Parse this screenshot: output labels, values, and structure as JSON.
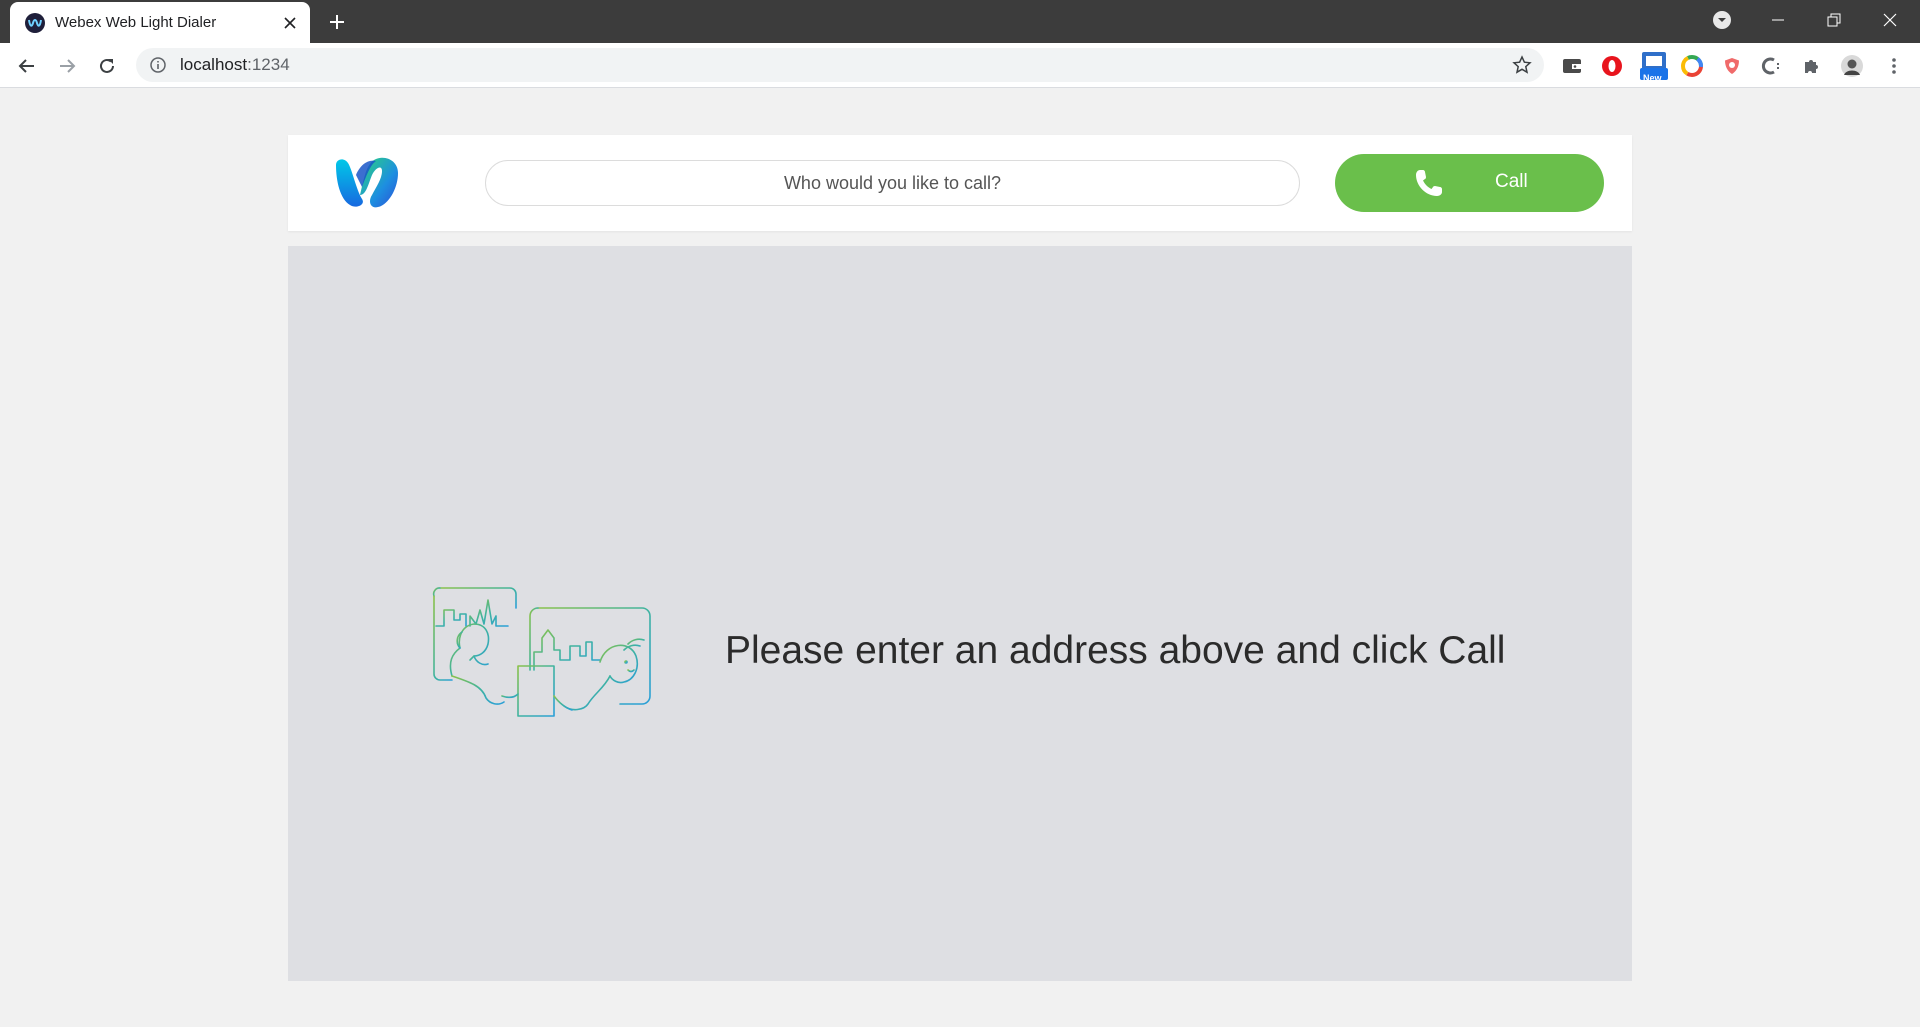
{
  "browser": {
    "tab_title": "Webex Web Light Dialer",
    "url_host": "localhost",
    "url_port": ":1234",
    "extensions": [
      "wallet-icon",
      "opera-icon",
      "new-badge-icon",
      "chrome-circle-icon",
      "shield-icon",
      "c-icon",
      "puzzle-icon",
      "profile-avatar"
    ],
    "new_badge": "New"
  },
  "header": {
    "search_placeholder": "Who would you like to call?",
    "call_label": "Call"
  },
  "main": {
    "message": "Please enter an address above and click Call"
  },
  "colors": {
    "call_green": "#6abf4b",
    "panel_bg": "#dedfe3",
    "page_bg": "#f1f1f1"
  }
}
